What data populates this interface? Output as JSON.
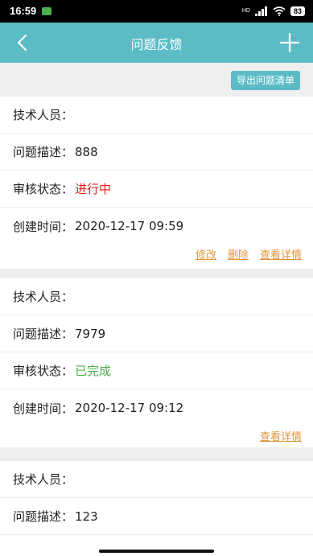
{
  "status_bar": {
    "time": "16:59",
    "signal_label": "HD",
    "battery": "83"
  },
  "nav": {
    "title": "问题反馈"
  },
  "toolbar": {
    "export_label": "导出问题清单"
  },
  "labels": {
    "technician": "技术人员：",
    "description": "问题描述：",
    "review_status": "审核状态：",
    "created_time": "创建时间："
  },
  "records": [
    {
      "technician": "",
      "description": "888",
      "review_status": "进行中",
      "created_time": "2020-12-17 09:59",
      "actions": {
        "edit": "修改",
        "delete": "删除",
        "details": "查看详情"
      }
    },
    {
      "technician": "",
      "description": "7979",
      "review_status": "已完成",
      "created_time": "2020-12-17 09:12",
      "actions": {
        "details": "查看详情"
      }
    },
    {
      "technician": "",
      "description": "123"
    }
  ],
  "colors": {
    "accent": "#5bbcc6",
    "in_progress": "#e02020",
    "completed": "#4cae4c",
    "link": "#e0953c"
  },
  "icons": {
    "back": "chevron-left-icon",
    "add": "plus-icon"
  }
}
